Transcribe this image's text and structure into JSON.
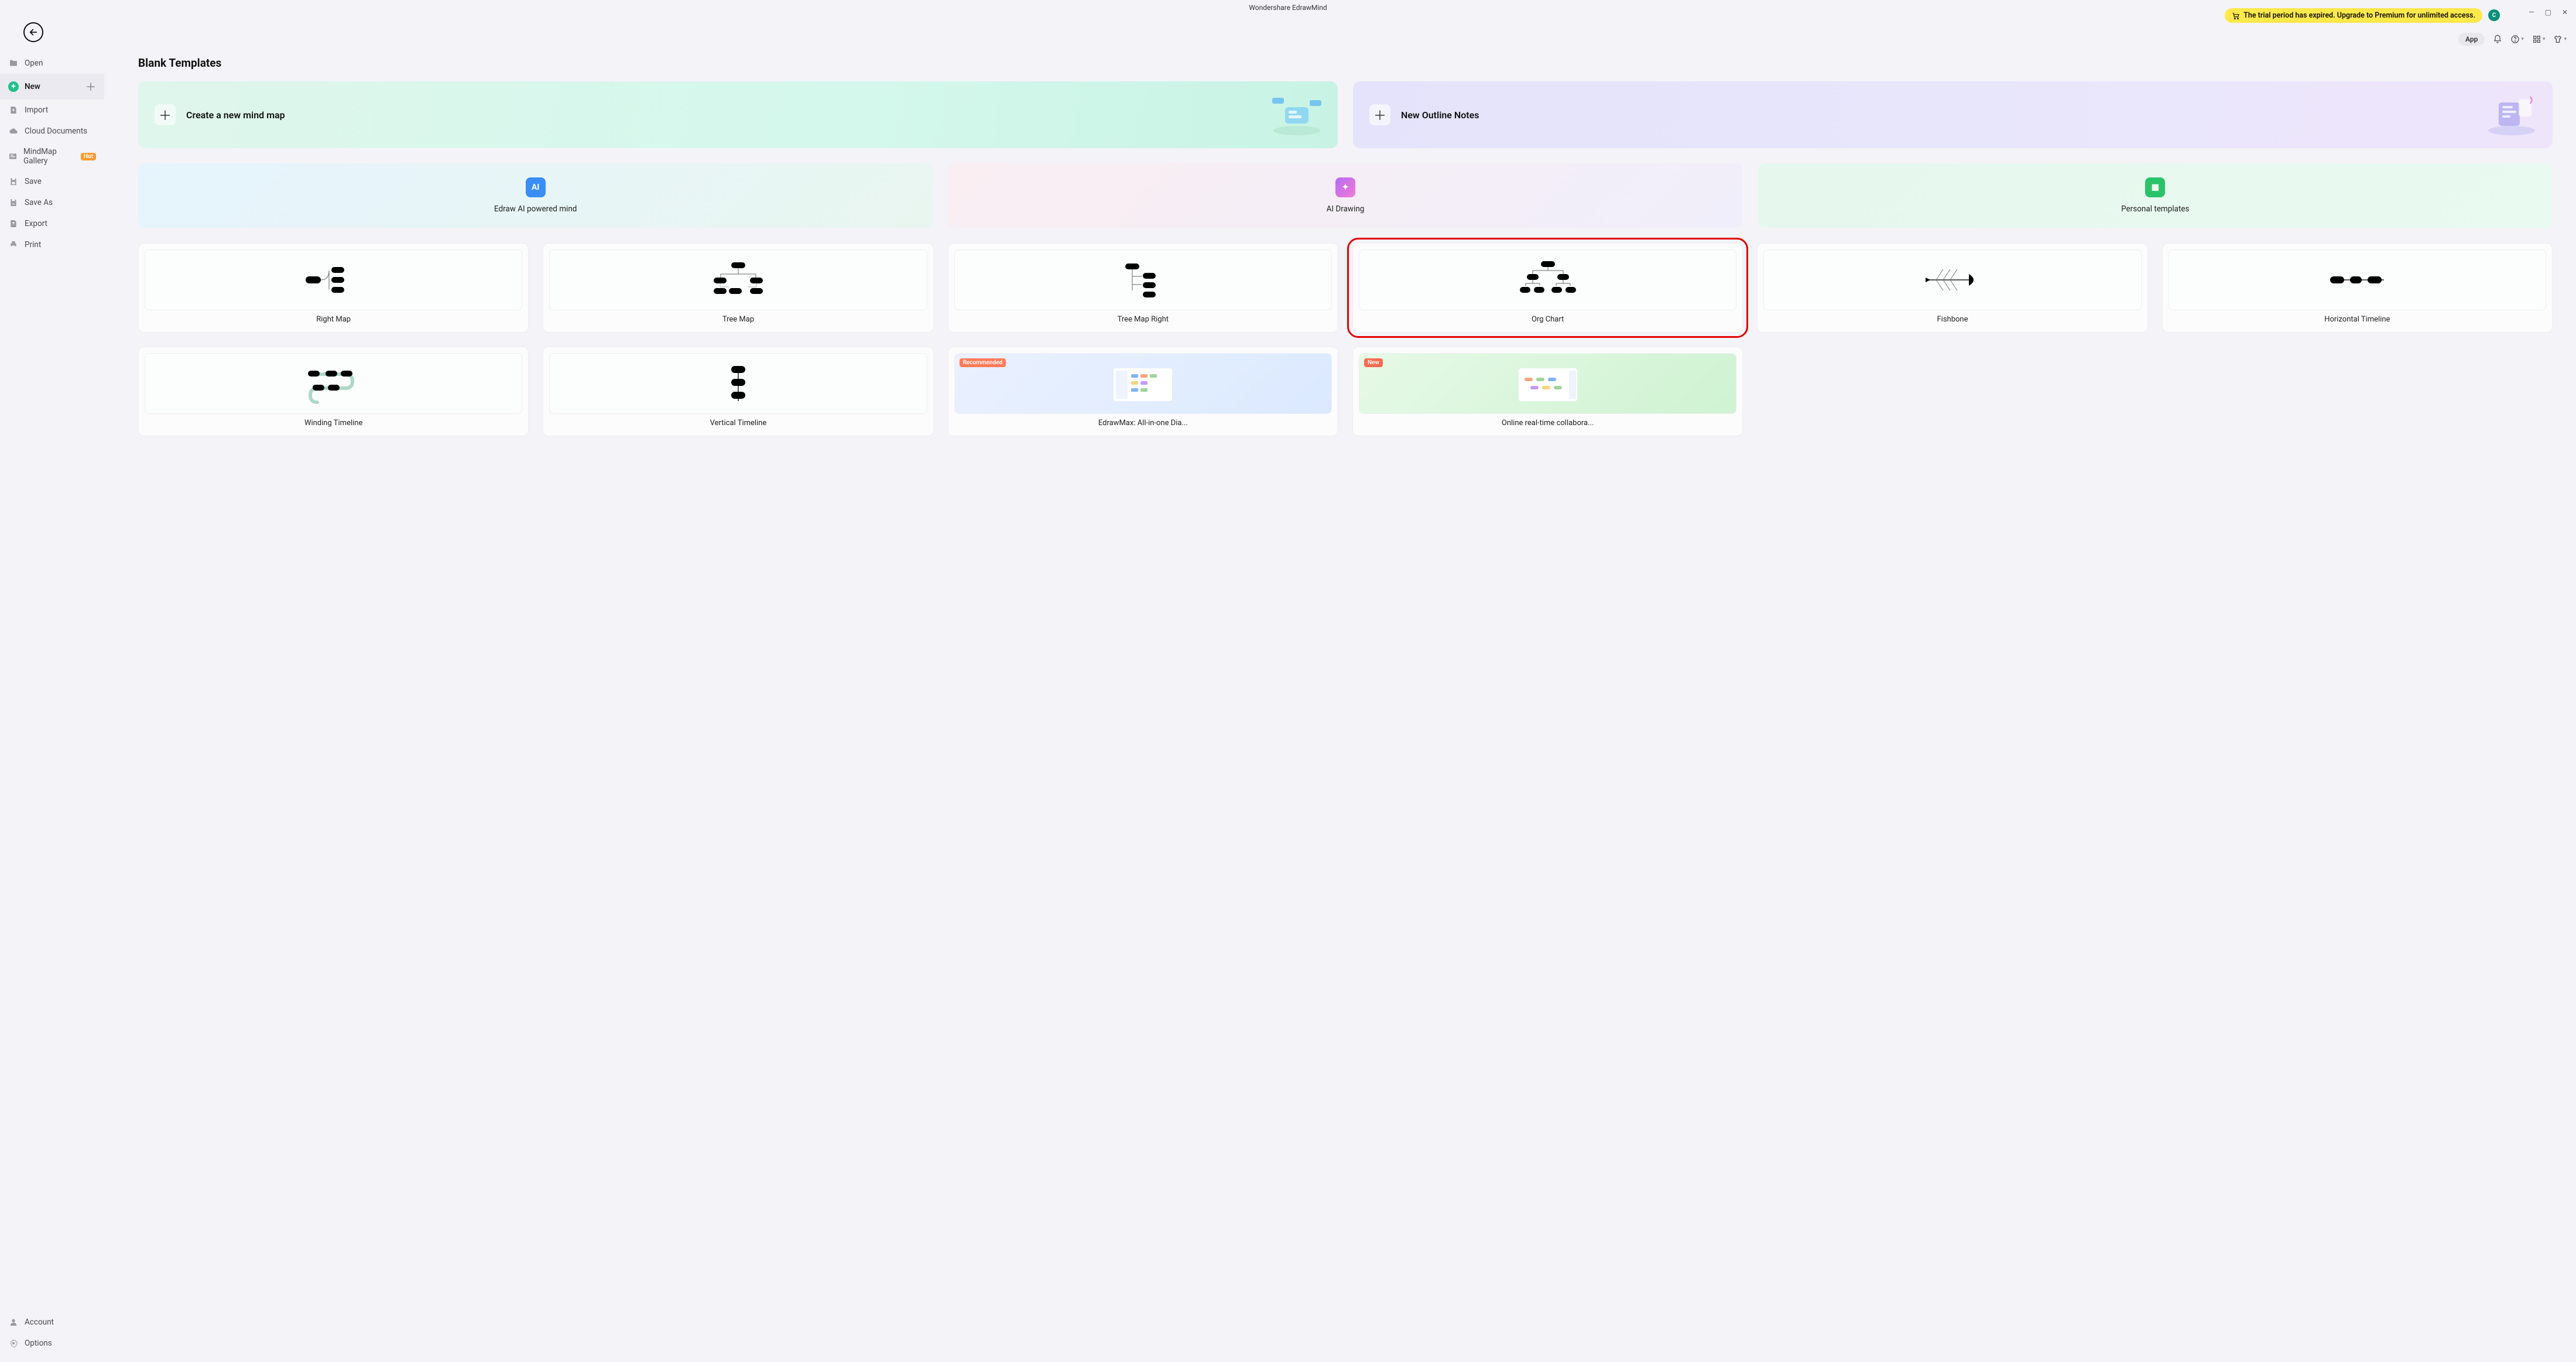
{
  "app_title": "Wondershare EdrawMind",
  "trial_banner": "The trial period has expired. Upgrade to Premium for unlimited access.",
  "avatar_letter": "C",
  "top": {
    "app_badge": "App"
  },
  "sidebar": {
    "items": [
      {
        "label": "Open"
      },
      {
        "label": "New"
      },
      {
        "label": "Import"
      },
      {
        "label": "Cloud Documents"
      },
      {
        "label": "MindMap Gallery",
        "badge": "Hot"
      },
      {
        "label": "Save"
      },
      {
        "label": "Save As"
      },
      {
        "label": "Export"
      },
      {
        "label": "Print"
      }
    ],
    "bottom": [
      {
        "label": "Account"
      },
      {
        "label": "Options"
      }
    ]
  },
  "page": {
    "title": "Blank Templates",
    "hero": [
      {
        "label": "Create a new mind map"
      },
      {
        "label": "New Outline Notes"
      }
    ],
    "features": [
      {
        "label": "Edraw AI powered mind",
        "icon": "AI"
      },
      {
        "label": "AI Drawing",
        "icon": "✦"
      },
      {
        "label": "Personal templates",
        "icon": "▦"
      }
    ],
    "templates": [
      {
        "label": "Right Map"
      },
      {
        "label": "Tree Map"
      },
      {
        "label": "Tree Map Right"
      },
      {
        "label": "Org Chart",
        "highlight": true
      },
      {
        "label": "Fishbone"
      },
      {
        "label": "Horizontal Timeline"
      },
      {
        "label": "Winding Timeline"
      },
      {
        "label": "Vertical Timeline"
      },
      {
        "label": "EdrawMax: All-in-one Dia...",
        "ribbon": "Recommended",
        "ribbon_kind": "rec"
      },
      {
        "label": "Online real-time collabora...",
        "ribbon": "New",
        "ribbon_kind": "new"
      }
    ]
  }
}
